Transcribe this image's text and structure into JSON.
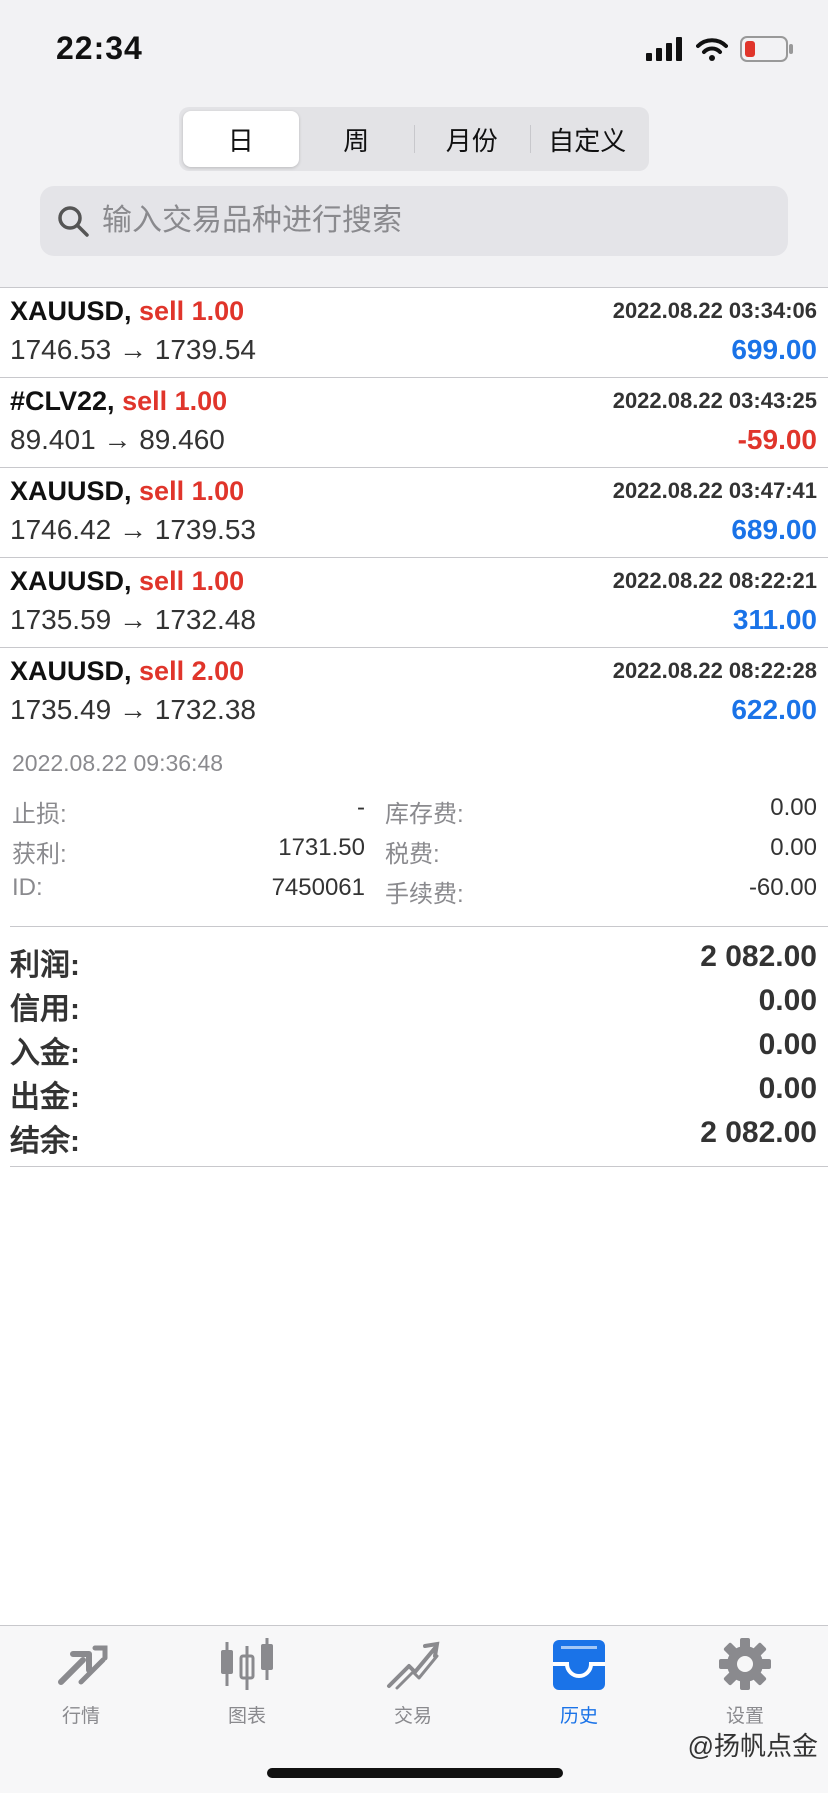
{
  "status_bar": {
    "time": "22:34"
  },
  "segments": [
    "日",
    "周",
    "月份",
    "自定义"
  ],
  "search": {
    "placeholder": "输入交易品种进行搜索"
  },
  "trades": [
    {
      "symbol": "XAUUSD,",
      "side": "sell 1.00",
      "time": "2022.08.22 03:34:06",
      "price": "1746.53 → 1739.54",
      "profit": "699.00",
      "profit_positive": true
    },
    {
      "symbol": "#CLV22,",
      "side": "sell 1.00",
      "time": "2022.08.22 03:43:25",
      "price": "89.401 → 89.460",
      "profit": "-59.00",
      "profit_positive": false
    },
    {
      "symbol": "XAUUSD,",
      "side": "sell 1.00",
      "time": "2022.08.22 03:47:41",
      "price": "1746.42 → 1739.53",
      "profit": "689.00",
      "profit_positive": true
    },
    {
      "symbol": "XAUUSD,",
      "side": "sell 1.00",
      "time": "2022.08.22 08:22:21",
      "price": "1735.59 → 1732.48",
      "profit": "311.00",
      "profit_positive": true
    },
    {
      "symbol": "XAUUSD,",
      "side": "sell 2.00",
      "time": "2022.08.22 08:22:28",
      "price": "1735.49 → 1732.38",
      "profit": "622.00",
      "profit_positive": true
    }
  ],
  "details": {
    "close_time": "2022.08.22 09:36:48",
    "sl_label": "止损:",
    "sl_value": "-",
    "tp_label": "获利:",
    "tp_value": "1731.50",
    "id_label": "ID:",
    "id_value": "7450061",
    "swap_label": "库存费:",
    "swap_value": "0.00",
    "tax_label": "税费:",
    "tax_value": "0.00",
    "fee_label": "手续费:",
    "fee_value": "-60.00"
  },
  "summary": [
    {
      "label": "利润:",
      "value": "2 082.00"
    },
    {
      "label": "信用:",
      "value": "0.00"
    },
    {
      "label": "入金:",
      "value": "0.00"
    },
    {
      "label": "出金:",
      "value": "0.00"
    },
    {
      "label": "结余:",
      "value": "2 082.00"
    }
  ],
  "tabbar": [
    {
      "label": "行情",
      "icon": "quotes-arrows-icon"
    },
    {
      "label": "图表",
      "icon": "candlestick-chart-icon"
    },
    {
      "label": "交易",
      "icon": "trade-trend-icon"
    },
    {
      "label": "历史",
      "icon": "history-inbox-icon",
      "active": true
    },
    {
      "label": "设置",
      "icon": "gear-icon"
    }
  ],
  "watermark": "@扬帆点金",
  "colors": {
    "sell": "#e0352b",
    "profit": "#1a73e8",
    "loss": "#e0352b",
    "active_tab": "#1a73e8"
  }
}
